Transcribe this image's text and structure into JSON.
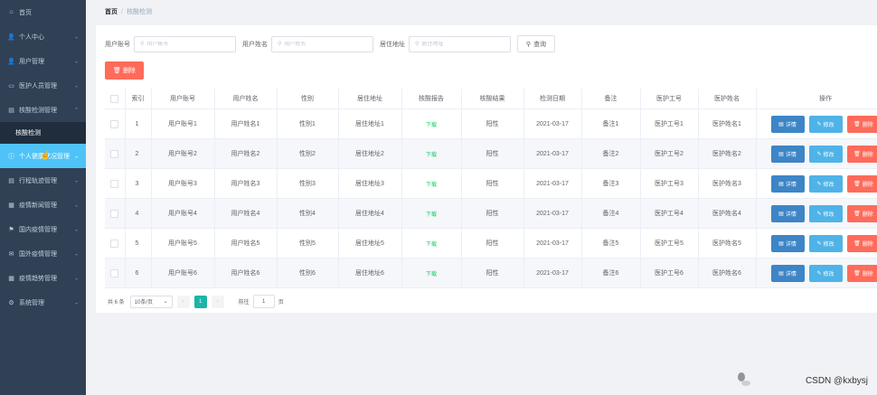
{
  "sidebar": {
    "items": [
      {
        "label": "首页",
        "icon": "home-icon",
        "glyph": "⌂"
      },
      {
        "label": "个人中心",
        "icon": "user-icon",
        "glyph": "👤",
        "arrow": "⌄"
      },
      {
        "label": "用户管理",
        "icon": "user-icon",
        "glyph": "👤",
        "arrow": "⌄"
      },
      {
        "label": "医护人员管理",
        "icon": "id-card-icon",
        "glyph": "▭",
        "arrow": "⌄"
      },
      {
        "label": "核酸检测管理",
        "icon": "document-icon",
        "glyph": "▤",
        "arrow": "⌃"
      }
    ],
    "sub_item": "核酸检测",
    "active_item": {
      "label": "个人健康状况管理",
      "icon": "info-icon",
      "glyph": "ⓘ",
      "arrow": "⌄"
    },
    "items_after": [
      {
        "label": "行程轨迹管理",
        "icon": "document-icon",
        "glyph": "▤",
        "arrow": "⌄"
      },
      {
        "label": "疫情新闻管理",
        "icon": "list-icon",
        "glyph": "▦",
        "arrow": "⌄"
      },
      {
        "label": "国内疫情管理",
        "icon": "flag-icon",
        "glyph": "⚑",
        "arrow": "⌄"
      },
      {
        "label": "国外疫情管理",
        "icon": "mail-icon",
        "glyph": "✉",
        "arrow": "⌄"
      },
      {
        "label": "疫情趋势管理",
        "icon": "list-icon",
        "glyph": "▦",
        "arrow": "⌄"
      },
      {
        "label": "系统管理",
        "icon": "gear-icon",
        "glyph": "⚙",
        "arrow": "⌄"
      }
    ]
  },
  "breadcrumb": {
    "home": "首页",
    "separator": "/",
    "current": "核酸检测"
  },
  "search": {
    "account_label": "用户账号",
    "account_placeholder": "用户账号",
    "name_label": "用户姓名",
    "name_placeholder": "用户姓名",
    "address_label": "居住地址",
    "address_placeholder": "居住地址",
    "query_label": "查询"
  },
  "toolbar": {
    "delete_label": "删除"
  },
  "table": {
    "headers": [
      "索引",
      "用户账号",
      "用户姓名",
      "性别",
      "居住地址",
      "核酸报告",
      "核酸结果",
      "检测日期",
      "备注",
      "医护工号",
      "医护姓名",
      "操作"
    ],
    "rows": [
      {
        "index": "1",
        "account": "用户账号1",
        "name": "用户姓名1",
        "gender": "性别1",
        "address": "居住地址1",
        "report": "下载",
        "result": "阳性",
        "date": "2021-03-17",
        "note": "备注1",
        "staff_id": "医护工号1",
        "staff_name": "医护姓名1"
      },
      {
        "index": "2",
        "account": "用户账号2",
        "name": "用户姓名2",
        "gender": "性别2",
        "address": "居住地址2",
        "report": "下载",
        "result": "阳性",
        "date": "2021-03-17",
        "note": "备注2",
        "staff_id": "医护工号2",
        "staff_name": "医护姓名2"
      },
      {
        "index": "3",
        "account": "用户账号3",
        "name": "用户姓名3",
        "gender": "性别3",
        "address": "居住地址3",
        "report": "下载",
        "result": "阳性",
        "date": "2021-03-17",
        "note": "备注3",
        "staff_id": "医护工号3",
        "staff_name": "医护姓名3"
      },
      {
        "index": "4",
        "account": "用户账号4",
        "name": "用户姓名4",
        "gender": "性别4",
        "address": "居住地址4",
        "report": "下载",
        "result": "阳性",
        "date": "2021-03-17",
        "note": "备注4",
        "staff_id": "医护工号4",
        "staff_name": "医护姓名4"
      },
      {
        "index": "5",
        "account": "用户账号5",
        "name": "用户姓名5",
        "gender": "性别5",
        "address": "居住地址5",
        "report": "下载",
        "result": "阳性",
        "date": "2021-03-17",
        "note": "备注5",
        "staff_id": "医护工号5",
        "staff_name": "医护姓名5"
      },
      {
        "index": "6",
        "account": "用户账号6",
        "name": "用户姓名6",
        "gender": "性别6",
        "address": "居住地址6",
        "report": "下载",
        "result": "阳性",
        "date": "2021-03-17",
        "note": "备注6",
        "staff_id": "医护工号6",
        "staff_name": "医护姓名6"
      }
    ],
    "actions": {
      "detail": "详情",
      "edit": "修改",
      "delete": "删除"
    }
  },
  "pagination": {
    "total": "共 6 条",
    "page_size": "10条/页",
    "current_page": "1",
    "goto_label": "前往",
    "goto_value": "1",
    "page_suffix": "页"
  },
  "watermark": "CSDN @kxbysj",
  "colors": {
    "sidebar_bg": "#304156",
    "active_item": "#4fc3f7",
    "danger": "#ff6b5b",
    "primary": "#3d85c6",
    "info": "#4fb3e8",
    "download": "#13ce66",
    "page_active": "#1bb5a6"
  }
}
